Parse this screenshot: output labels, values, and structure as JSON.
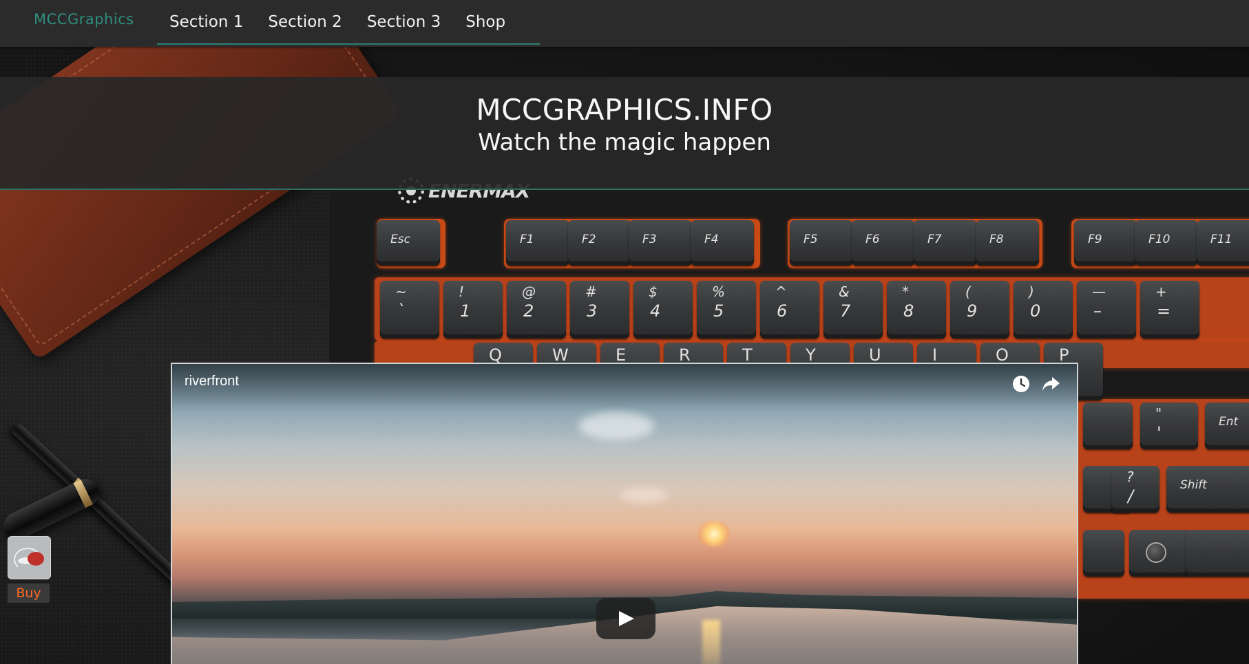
{
  "nav": {
    "brand": "MCCGraphics",
    "links": [
      "Section 1",
      "Section 2",
      "Section 3",
      "Shop"
    ]
  },
  "hero": {
    "title": "MCCGRAPHICS.INFO",
    "subtitle": "Watch the magic happen"
  },
  "video": {
    "title": "riverfront",
    "icons": [
      "watch-later-icon",
      "share-icon",
      "play-icon"
    ]
  },
  "buy_widget": {
    "label": "Buy"
  },
  "background": {
    "keyboard_brand": "ENERMAX",
    "fn_keys": [
      "Esc",
      "F1",
      "F2",
      "F3",
      "F4",
      "F5",
      "F6",
      "F7",
      "F8",
      "F9",
      "F10",
      "F11"
    ],
    "number_keys": [
      {
        "top": "~",
        "bot": "`"
      },
      {
        "top": "!",
        "bot": "1"
      },
      {
        "top": "@",
        "bot": "2"
      },
      {
        "top": "#",
        "bot": "3"
      },
      {
        "top": "$",
        "bot": "4"
      },
      {
        "top": "%",
        "bot": "5"
      },
      {
        "top": "^",
        "bot": "6"
      },
      {
        "top": "&",
        "bot": "7"
      },
      {
        "top": "*",
        "bot": "8"
      },
      {
        "top": "(",
        "bot": "9"
      },
      {
        "top": ")",
        "bot": "0"
      },
      {
        "top": "—",
        "bot": "–"
      },
      {
        "top": "+",
        "bot": "="
      }
    ],
    "qwerty_keys": [
      "Q",
      "W",
      "E",
      "R",
      "T",
      "Y",
      "U",
      "I",
      "O",
      "P"
    ],
    "side_keys": [
      "Ent",
      "Shift",
      "?",
      "/"
    ]
  },
  "colors": {
    "accent": "#2f8f7e",
    "buy_text": "#ff6a22",
    "navbar_bg": "#2b2b2b",
    "keyboard_glow": "#c84a16"
  }
}
